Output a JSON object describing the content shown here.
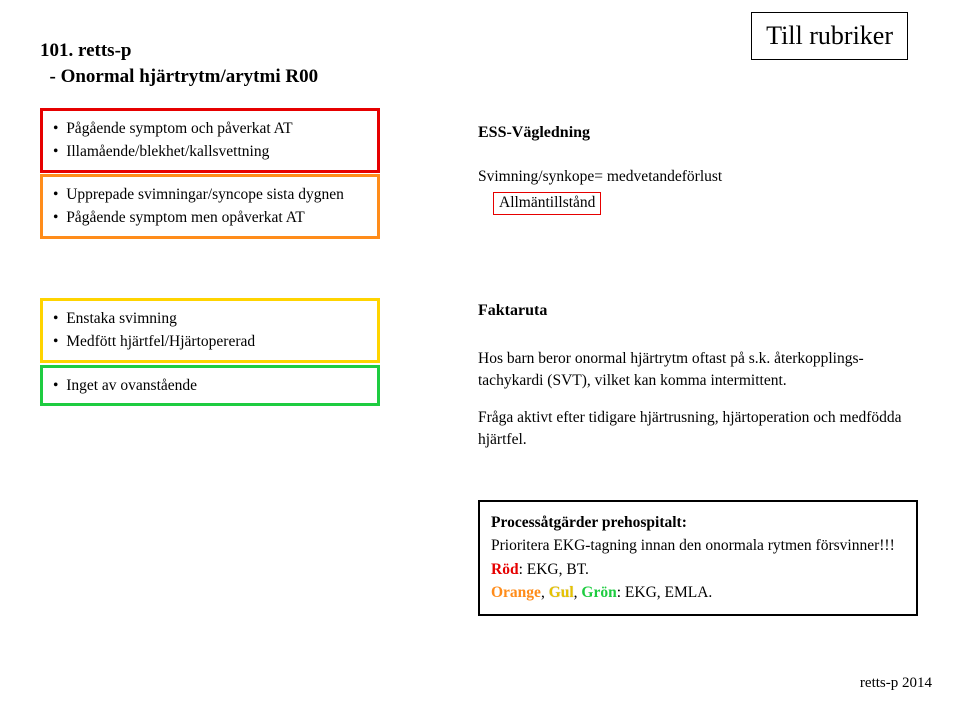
{
  "header": {
    "code": "101. retts-p",
    "title": "- Onormal hjärtrytm/arytmi R00",
    "link_label": "Till rubriker"
  },
  "priorities": {
    "red": [
      "Pågående symptom och påverkat AT",
      "Illamående/blekhet/kallsvettning"
    ],
    "orange": [
      "Upprepade svimningar/syncope sista dygnen",
      "Pågående symptom men opåverkat AT"
    ],
    "yellow": [
      "Enstaka svimning",
      "Medfött hjärtfel/Hjärtopererad"
    ],
    "green": [
      "Inget av ovanstående"
    ]
  },
  "ess": {
    "title": "ESS-Vägledning",
    "line": "Svimning/synkope= medvetandeförlust",
    "link_label": "Allmäntillstånd"
  },
  "fact": {
    "title": "Faktaruta",
    "p1": "Hos barn beror onormal hjärtrytm oftast på s.k. återkopplings-tachykardi (SVT), vilket kan komma intermittent.",
    "p2": "Fråga aktivt efter tidigare hjärtrusning, hjärtoperation och medfödda hjärtfel."
  },
  "proc": {
    "title": "Processåtgärder prehospitalt:",
    "line1": "Prioritera EKG-tagning innan den onormala rytmen försvinner!!!",
    "red_label": "Röd",
    "red_text": ": EKG, BT.",
    "orange_label": "Orange",
    "sep1": ", ",
    "yellow_label": "Gul",
    "sep2": ", ",
    "green_label": "Grön",
    "oyg_text": ": EKG, EMLA."
  },
  "footer": "retts-p 2014"
}
